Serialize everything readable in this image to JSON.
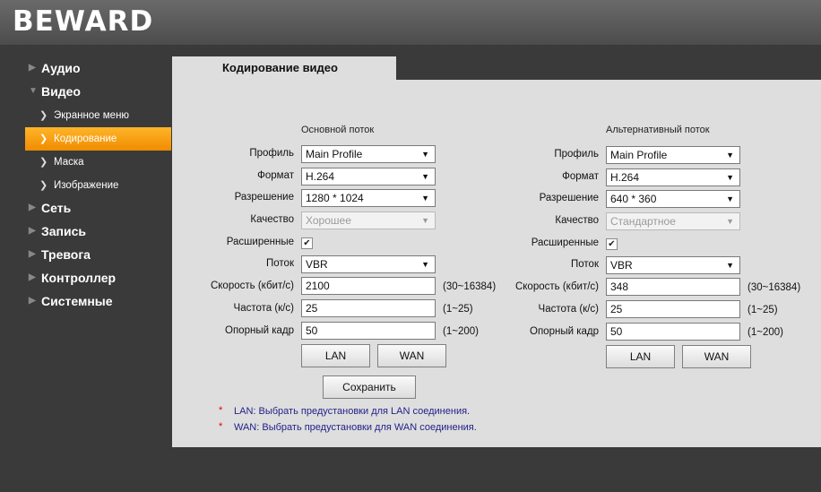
{
  "brand": {
    "logo": "BEWARD"
  },
  "sidebar": {
    "audio": "Аудио",
    "video": "Видео",
    "video_items": [
      "Экранное меню",
      "Кодирование",
      "Маска",
      "Изображение"
    ],
    "network": "Сеть",
    "record": "Запись",
    "alarm": "Тревога",
    "controller": "Контроллер",
    "system": "Системные"
  },
  "tab": {
    "title": "Кодирование видео"
  },
  "labels": {
    "profile": "Профиль",
    "format": "Формат",
    "resolution": "Разрешение",
    "quality": "Качество",
    "advanced": "Расширенные",
    "stream": "Поток",
    "bitrate": "Скорость (кбит/с)",
    "framerate": "Частота (к/с)",
    "gop": "Опорный кадр",
    "lan": "LAN",
    "wan": "WAN"
  },
  "main_stream": {
    "title": "Основной поток",
    "profile": "Main Profile",
    "format": "H.264",
    "resolution": "1280 * 1024",
    "quality": "Хорошее",
    "advanced_checked": true,
    "stream": "VBR",
    "bitrate": "2100",
    "bitrate_range": "(30~16384)",
    "framerate": "25",
    "framerate_range": "(1~25)",
    "gop": "50",
    "gop_range": "(1~200)"
  },
  "alt_stream": {
    "title": "Альтернативный поток",
    "profile": "Main Profile",
    "format": "H.264",
    "resolution": "640 * 360",
    "quality": "Стандартное",
    "advanced_checked": true,
    "stream": "VBR",
    "bitrate": "348",
    "bitrate_range": "(30~16384)",
    "framerate": "25",
    "framerate_range": "(1~25)",
    "gop": "50",
    "gop_range": "(1~200)"
  },
  "save_label": "Сохранить",
  "notes": {
    "star": "*",
    "lan": "LAN: Выбрать предустановки для LAN соединения.",
    "wan": "WAN: Выбрать предустановки для WAN соединения."
  },
  "colors": {
    "active_nav": "#f5a000",
    "panel": "#dedede",
    "note_text": "#22228a",
    "note_star": "#e00000"
  }
}
